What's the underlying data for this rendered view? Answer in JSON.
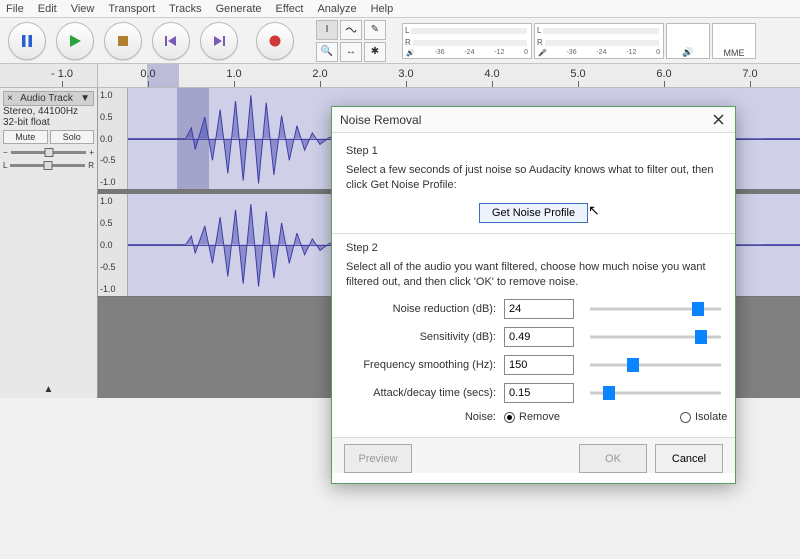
{
  "menu": {
    "items": [
      "File",
      "Edit",
      "View",
      "Transport",
      "Tracks",
      "Generate",
      "Effect",
      "Analyze",
      "Help"
    ]
  },
  "meters": {
    "play": {
      "lr": [
        "L",
        "R"
      ],
      "scale": [
        "-36",
        "-24",
        "-12",
        "0"
      ]
    },
    "rec": {
      "lr": [
        "L",
        "R"
      ],
      "scale": [
        "-36",
        "-24",
        "-12",
        "0"
      ]
    }
  },
  "device": {
    "host_label": "MME"
  },
  "ruler": {
    "labels": [
      "- 1.0",
      "0.0",
      "1.0",
      "2.0",
      "3.0",
      "4.0",
      "5.0",
      "6.0",
      "7.0"
    ]
  },
  "track": {
    "close": "×",
    "name": "Audio Track",
    "menu_glyph": "▼",
    "format_line1": "Stereo, 44100Hz",
    "format_line2": "32-bit float",
    "mute": "Mute",
    "solo": "Solo",
    "gain_minus": "−",
    "gain_plus": "+",
    "pan_left": "L",
    "pan_right": "R",
    "collapse": "▲",
    "scale": {
      "p1": "1.0",
      "p05": "0.5",
      "z": "0.0",
      "n05": "-0.5",
      "n1": "-1.0"
    }
  },
  "dialog": {
    "title": "Noise Removal",
    "step1": "Step 1",
    "step1_text": "Select a few seconds of just noise so Audacity knows what to filter out, then click Get Noise Profile:",
    "get_profile": "Get Noise Profile",
    "step2": "Step 2",
    "step2_text": "Select all of the audio you want filtered, choose how much noise you want filtered out, and then click 'OK' to remove noise.",
    "labels": {
      "reduction": "Noise reduction (dB):",
      "sensitivity": "Sensitivity (dB):",
      "smoothing": "Frequency smoothing (Hz):",
      "attack": "Attack/decay time (secs):",
      "noise": "Noise:"
    },
    "values": {
      "reduction": "24",
      "sensitivity": "0.49",
      "smoothing": "150",
      "attack": "0.15"
    },
    "radio": {
      "remove": "Remove",
      "isolate": "Isolate",
      "selected": "remove"
    },
    "buttons": {
      "preview": "Preview",
      "ok": "OK",
      "cancel": "Cancel"
    }
  }
}
